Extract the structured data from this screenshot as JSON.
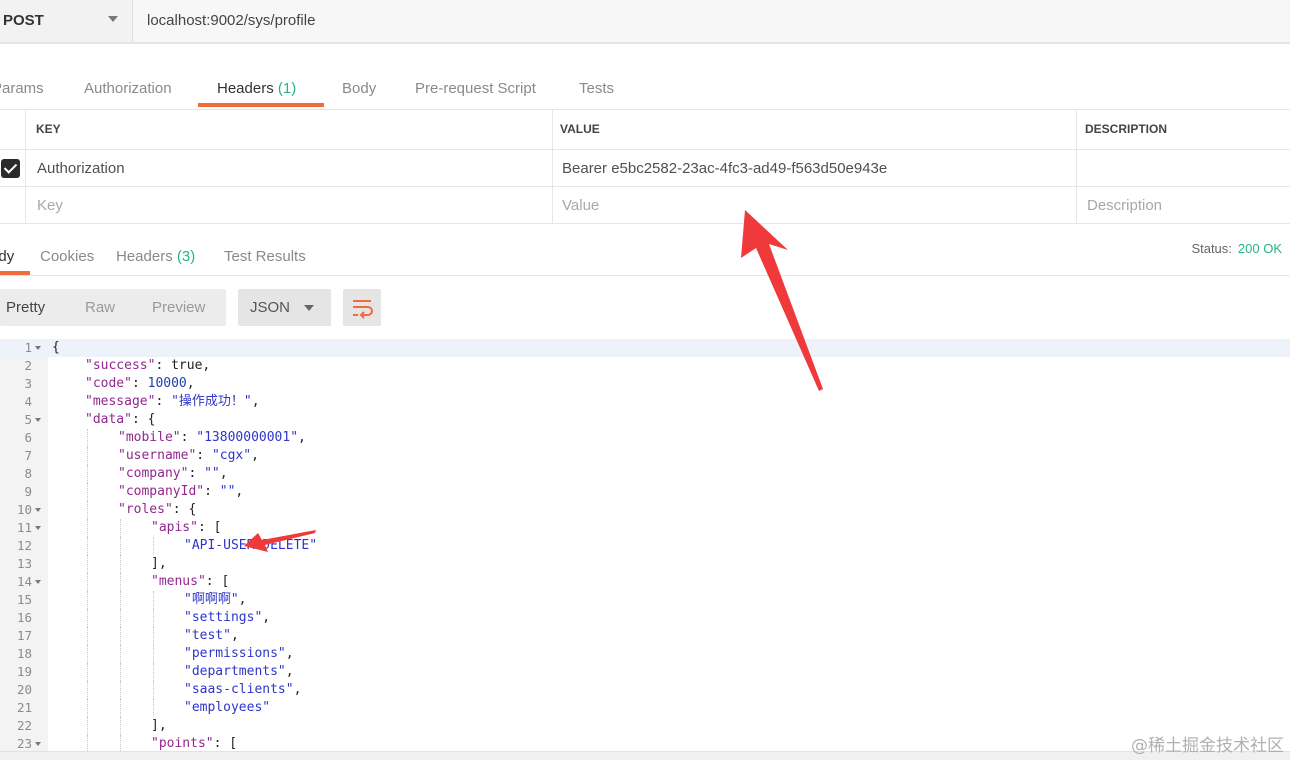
{
  "request": {
    "method": "POST",
    "url": "localhost:9002/sys/profile"
  },
  "request_tabs": [
    {
      "label": "Params"
    },
    {
      "label": "Authorization"
    },
    {
      "label": "Headers",
      "count": "(1)"
    },
    {
      "label": "Body"
    },
    {
      "label": "Pre-request Script"
    },
    {
      "label": "Tests"
    }
  ],
  "headers_table": {
    "columns": [
      "KEY",
      "VALUE",
      "DESCRIPTION"
    ],
    "rows": [
      {
        "checked": true,
        "key": "Authorization",
        "value": "Bearer e5bc2582-23ac-4fc3-ad49-f563d50e943e",
        "description": ""
      }
    ],
    "placeholders": {
      "key": "Key",
      "value": "Value",
      "description": "Description"
    }
  },
  "response_tabs": [
    {
      "label": "Body"
    },
    {
      "label": "Cookies"
    },
    {
      "label": "Headers",
      "count": "(3)"
    },
    {
      "label": "Test Results"
    }
  ],
  "status": {
    "label": "Status:",
    "value": "200 OK"
  },
  "format": {
    "modes": [
      "Pretty",
      "Raw",
      "Preview"
    ],
    "language": "JSON"
  },
  "code_lines": [
    {
      "n": "1",
      "fold": true,
      "indent": 0,
      "parts": [
        [
          "p",
          "{"
        ]
      ]
    },
    {
      "n": "2",
      "fold": false,
      "indent": 1,
      "parts": [
        [
          "k",
          "\"success\""
        ],
        [
          "p",
          ": true,"
        ]
      ]
    },
    {
      "n": "3",
      "fold": false,
      "indent": 1,
      "parts": [
        [
          "k",
          "\"code\""
        ],
        [
          "p",
          ": "
        ],
        [
          "n",
          "10000"
        ],
        [
          "p",
          ","
        ]
      ]
    },
    {
      "n": "4",
      "fold": false,
      "indent": 1,
      "parts": [
        [
          "k",
          "\"message\""
        ],
        [
          "p",
          ": "
        ],
        [
          "s",
          "\"操作成功！\""
        ],
        [
          "p",
          ","
        ]
      ]
    },
    {
      "n": "5",
      "fold": true,
      "indent": 1,
      "parts": [
        [
          "k",
          "\"data\""
        ],
        [
          "p",
          ": {"
        ]
      ]
    },
    {
      "n": "6",
      "fold": false,
      "indent": 2,
      "parts": [
        [
          "k",
          "\"mobile\""
        ],
        [
          "p",
          ": "
        ],
        [
          "s",
          "\"13800000001\""
        ],
        [
          "p",
          ","
        ]
      ]
    },
    {
      "n": "7",
      "fold": false,
      "indent": 2,
      "parts": [
        [
          "k",
          "\"username\""
        ],
        [
          "p",
          ": "
        ],
        [
          "s",
          "\"cgx\""
        ],
        [
          "p",
          ","
        ]
      ]
    },
    {
      "n": "8",
      "fold": false,
      "indent": 2,
      "parts": [
        [
          "k",
          "\"company\""
        ],
        [
          "p",
          ": "
        ],
        [
          "s",
          "\"\""
        ],
        [
          "p",
          ","
        ]
      ]
    },
    {
      "n": "9",
      "fold": false,
      "indent": 2,
      "parts": [
        [
          "k",
          "\"companyId\""
        ],
        [
          "p",
          ": "
        ],
        [
          "s",
          "\"\""
        ],
        [
          "p",
          ","
        ]
      ]
    },
    {
      "n": "10",
      "fold": true,
      "indent": 2,
      "parts": [
        [
          "k",
          "\"roles\""
        ],
        [
          "p",
          ": {"
        ]
      ]
    },
    {
      "n": "11",
      "fold": true,
      "indent": 3,
      "parts": [
        [
          "k",
          "\"apis\""
        ],
        [
          "p",
          ": ["
        ]
      ]
    },
    {
      "n": "12",
      "fold": false,
      "indent": 4,
      "parts": [
        [
          "s",
          "\"API-USER-DELETE\""
        ]
      ]
    },
    {
      "n": "13",
      "fold": false,
      "indent": 3,
      "parts": [
        [
          "p",
          "],"
        ]
      ]
    },
    {
      "n": "14",
      "fold": true,
      "indent": 3,
      "parts": [
        [
          "k",
          "\"menus\""
        ],
        [
          "p",
          ": ["
        ]
      ]
    },
    {
      "n": "15",
      "fold": false,
      "indent": 4,
      "parts": [
        [
          "s",
          "\"啊啊啊\""
        ],
        [
          "p",
          ","
        ]
      ]
    },
    {
      "n": "16",
      "fold": false,
      "indent": 4,
      "parts": [
        [
          "s",
          "\"settings\""
        ],
        [
          "p",
          ","
        ]
      ]
    },
    {
      "n": "17",
      "fold": false,
      "indent": 4,
      "parts": [
        [
          "s",
          "\"test\""
        ],
        [
          "p",
          ","
        ]
      ]
    },
    {
      "n": "18",
      "fold": false,
      "indent": 4,
      "parts": [
        [
          "s",
          "\"permissions\""
        ],
        [
          "p",
          ","
        ]
      ]
    },
    {
      "n": "19",
      "fold": false,
      "indent": 4,
      "parts": [
        [
          "s",
          "\"departments\""
        ],
        [
          "p",
          ","
        ]
      ]
    },
    {
      "n": "20",
      "fold": false,
      "indent": 4,
      "parts": [
        [
          "s",
          "\"saas-clients\""
        ],
        [
          "p",
          ","
        ]
      ]
    },
    {
      "n": "21",
      "fold": false,
      "indent": 4,
      "parts": [
        [
          "s",
          "\"employees\""
        ]
      ]
    },
    {
      "n": "22",
      "fold": false,
      "indent": 3,
      "parts": [
        [
          "p",
          "],"
        ]
      ]
    },
    {
      "n": "23",
      "fold": true,
      "indent": 3,
      "parts": [
        [
          "k",
          "\"points\""
        ],
        [
          "p",
          ": ["
        ]
      ]
    }
  ],
  "annotations": {
    "arrow_color": "#f0393a"
  },
  "watermark": "@稀土掘金技术社区"
}
